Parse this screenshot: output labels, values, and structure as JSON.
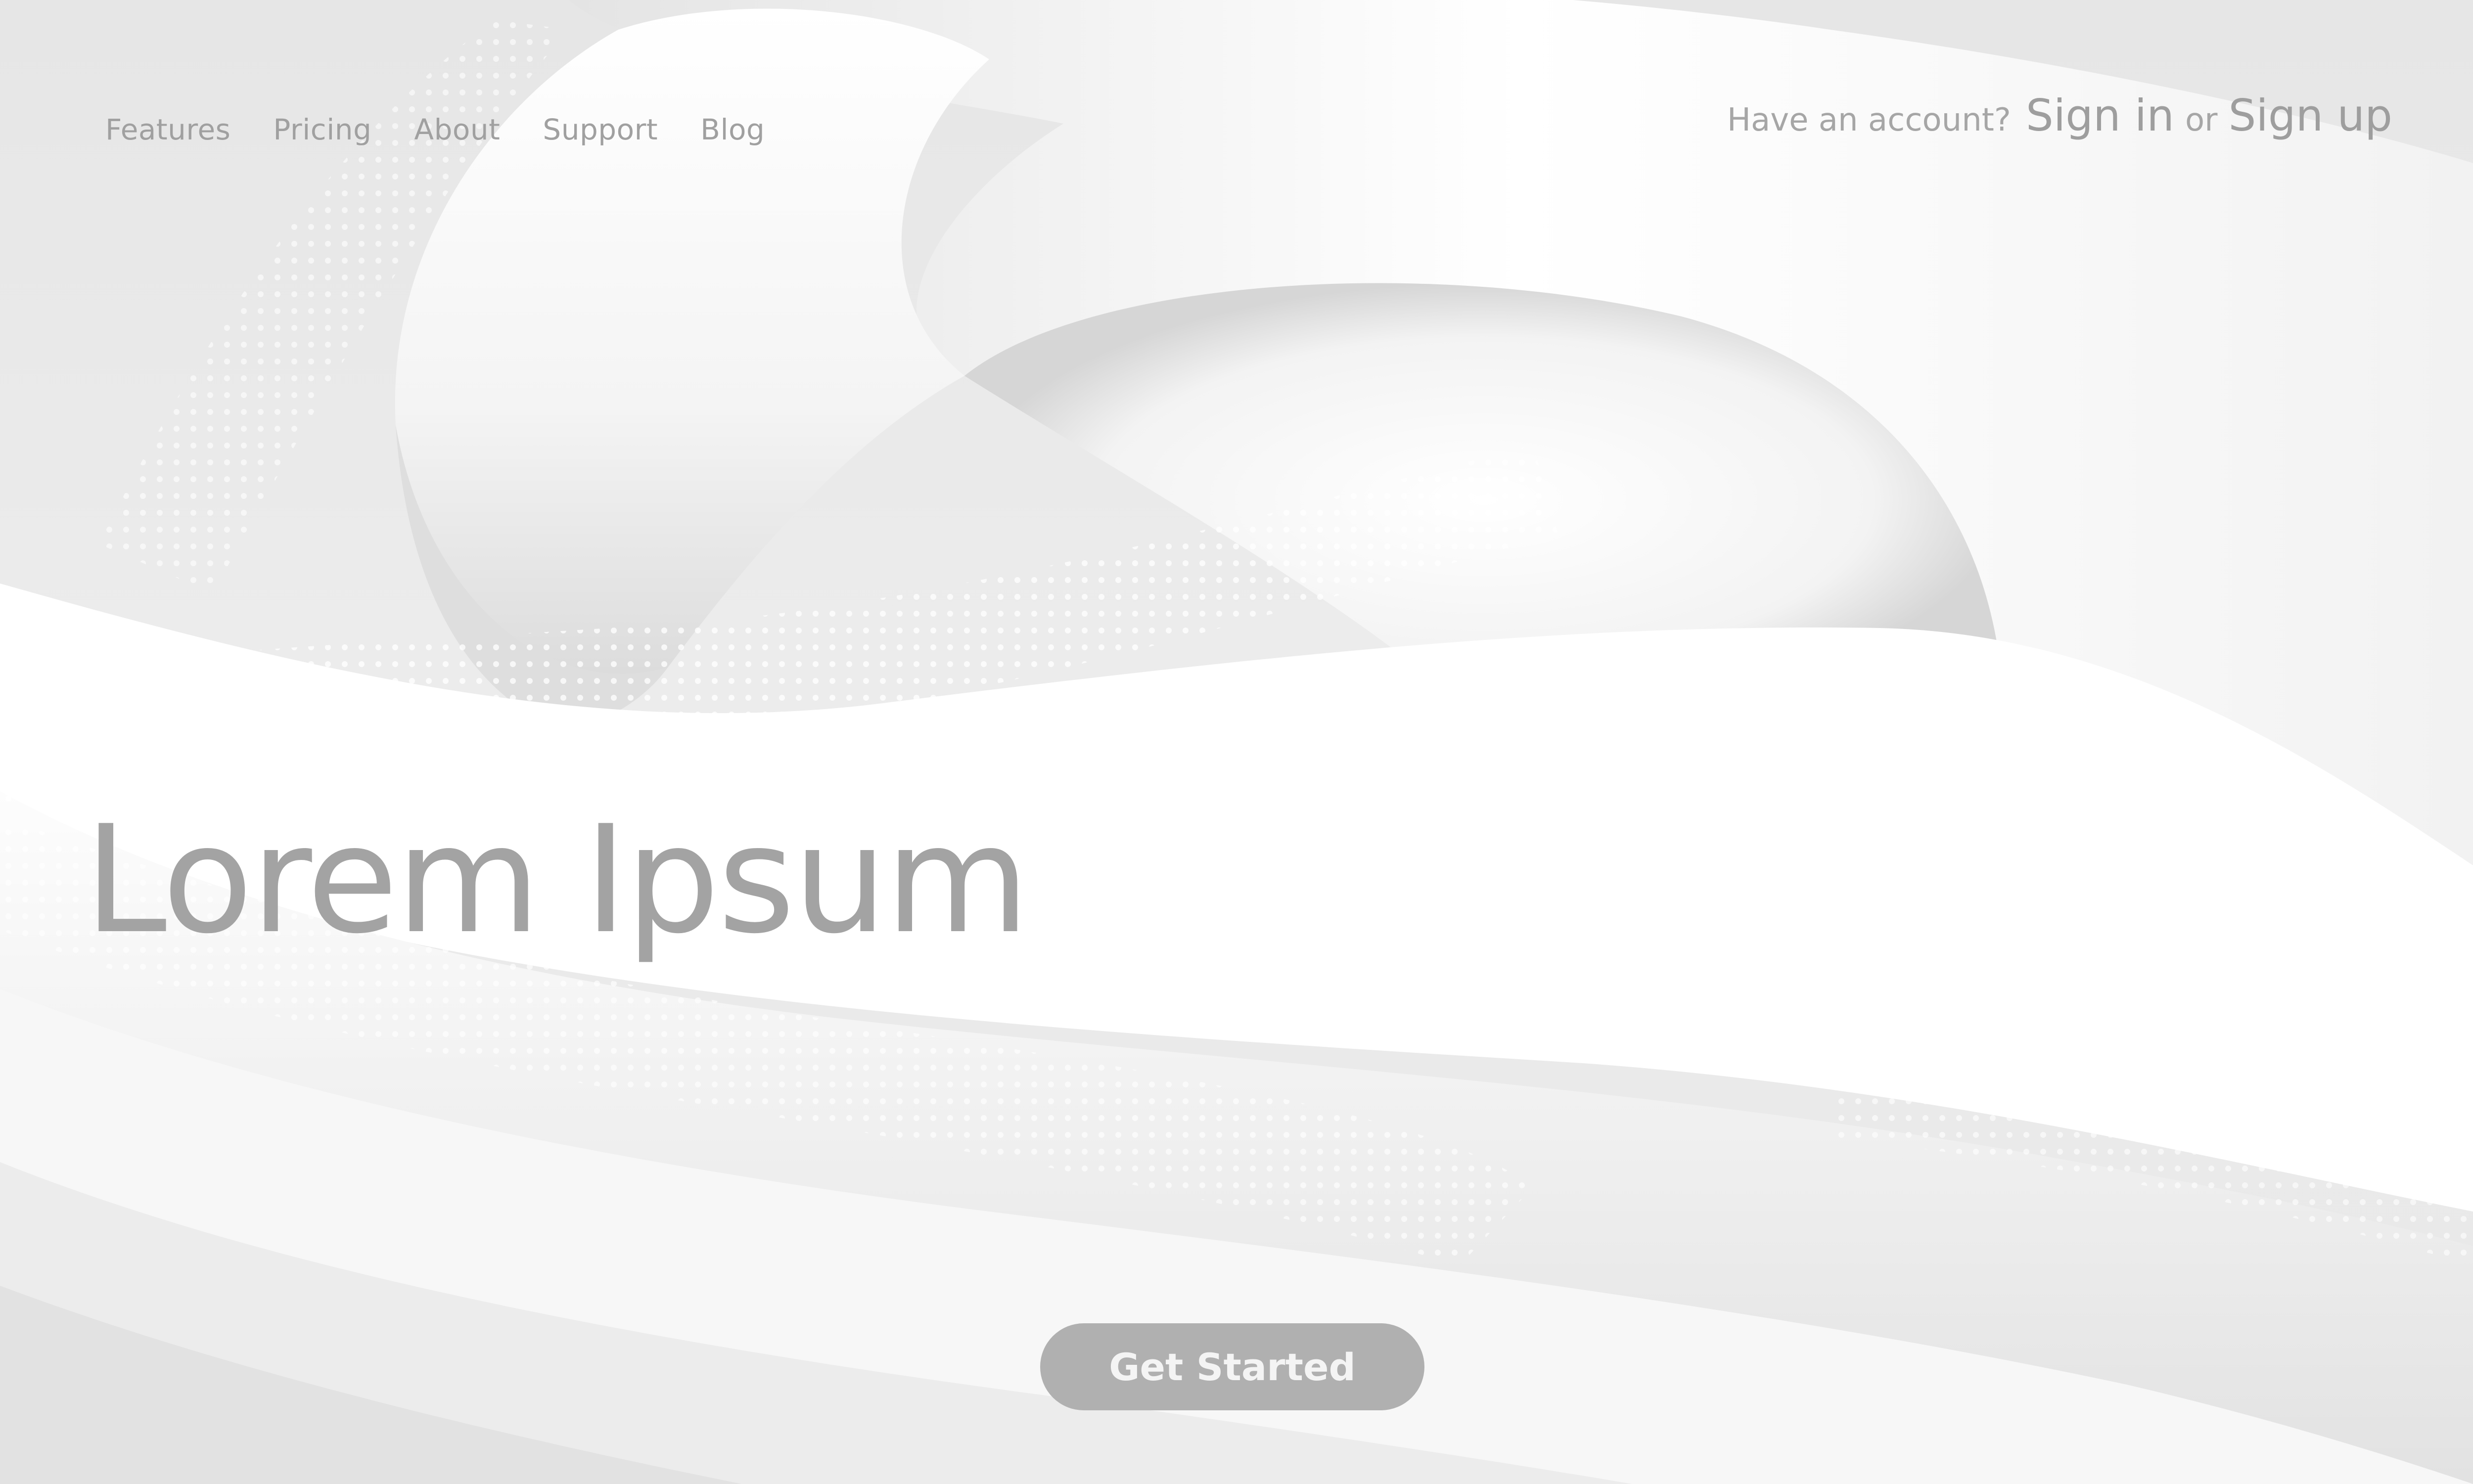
{
  "nav": {
    "items": [
      {
        "label": "Features"
      },
      {
        "label": "Pricing"
      },
      {
        "label": "About"
      },
      {
        "label": "Support"
      },
      {
        "label": "Blog"
      }
    ]
  },
  "account": {
    "prompt": "Have an account?",
    "sign_in": "Sign in",
    "or": "or",
    "sign_up": "Sign up"
  },
  "hero": {
    "title": "Lorem Ipsum",
    "cta_label": "Get Started"
  },
  "colors": {
    "background": "#e9e9e9",
    "wave_white": "#ffffff",
    "text_gray": "#a3a3a3",
    "button_gray": "#b0b0b0",
    "button_text": "#f4f4f4"
  }
}
